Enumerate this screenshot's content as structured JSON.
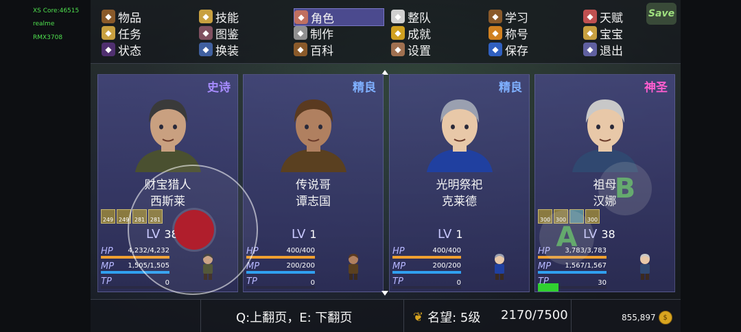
{
  "debug": [
    "XS Core:46515",
    "realme",
    "RMX3708"
  ],
  "menu": {
    "items": [
      {
        "label": "物品",
        "icon": "bag-icon",
        "color": "#8a5a2a"
      },
      {
        "label": "技能",
        "icon": "scroll-star-icon",
        "color": "#c8a040"
      },
      {
        "label": "角色",
        "icon": "masks-icon",
        "color": "#c07060",
        "active": true
      },
      {
        "label": "整队",
        "icon": "flag-icon",
        "color": "#d0d0d0"
      },
      {
        "label": "学习",
        "icon": "book-icon",
        "color": "#8a5a2a"
      },
      {
        "label": "天赋",
        "icon": "gift-icon",
        "color": "#c05050"
      },
      {
        "label": "任务",
        "icon": "quest-scroll-icon",
        "color": "#c8a040"
      },
      {
        "label": "图鉴",
        "icon": "monster-book-icon",
        "color": "#805060"
      },
      {
        "label": "制作",
        "icon": "anvil-icon",
        "color": "#909090"
      },
      {
        "label": "成就",
        "icon": "trophy-icon",
        "color": "#d0a020"
      },
      {
        "label": "称号",
        "icon": "medal-icon",
        "color": "#d08020"
      },
      {
        "label": "宝宝",
        "icon": "pet-icon",
        "color": "#c8a040"
      },
      {
        "label": "状态",
        "icon": "status-orb-icon",
        "color": "#503070"
      },
      {
        "label": "换装",
        "icon": "outfit-icon",
        "color": "#4060a0"
      },
      {
        "label": "百科",
        "icon": "encyclopedia-icon",
        "color": "#8a5a2a"
      },
      {
        "label": "设置",
        "icon": "gear-icon",
        "color": "#a07050"
      },
      {
        "label": "保存",
        "icon": "floppy-icon",
        "color": "#3060c0"
      },
      {
        "label": "退出",
        "icon": "exit-icon",
        "color": "#6060a0"
      }
    ],
    "save_label": "Save"
  },
  "characters": [
    {
      "rarity": "史诗",
      "rarity_color": "#a78cff",
      "name_line1": "财宝猎人",
      "name_line2": "西斯莱",
      "equip": [
        "249",
        "249",
        "281",
        "281"
      ],
      "lv_label": "LV",
      "lv": "38",
      "hp_label": "HP",
      "hp": "4,232/4,232",
      "hp_ratio": 1.0,
      "mp_label": "MP",
      "mp": "1,505/1,505",
      "mp_ratio": 1.0,
      "tp_label": "TP",
      "tp": "0",
      "tp_ratio": 0.0,
      "hair": "#3a3a3a",
      "skin": "#c9a080",
      "outfit": "#4a5030"
    },
    {
      "rarity": "精良",
      "rarity_color": "#7fb0ff",
      "name_line1": "传说哥",
      "name_line2": "谭志国",
      "equip": [],
      "lv_label": "LV",
      "lv": "1",
      "hp_label": "HP",
      "hp": "400/400",
      "hp_ratio": 1.0,
      "mp_label": "MP",
      "mp": "200/200",
      "mp_ratio": 1.0,
      "tp_label": "TP",
      "tp": "0",
      "tp_ratio": 0.0,
      "hair": "#5a3a20",
      "skin": "#b08060",
      "outfit": "#5a4020"
    },
    {
      "rarity": "精良",
      "rarity_color": "#7fb0ff",
      "name_line1": "光明祭祀",
      "name_line2": "克莱德",
      "equip": [],
      "lv_label": "LV",
      "lv": "1",
      "hp_label": "HP",
      "hp": "400/400",
      "hp_ratio": 1.0,
      "mp_label": "MP",
      "mp": "200/200",
      "mp_ratio": 1.0,
      "tp_label": "TP",
      "tp": "0",
      "tp_ratio": 0.0,
      "hair": "#9aa0b0",
      "skin": "#e8c8a8",
      "outfit": "#2040a0"
    },
    {
      "rarity": "神圣",
      "rarity_color": "#ff5ed0",
      "name_line1": "祖母",
      "name_line2": "汉娜",
      "equip": [
        "300",
        "300",
        "",
        "300"
      ],
      "lv_label": "LV",
      "lv": "38",
      "hp_label": "HP",
      "hp": "3,783/3,783",
      "hp_ratio": 1.0,
      "mp_label": "MP",
      "mp": "1,567/1,567",
      "mp_ratio": 1.0,
      "tp_label": "TP",
      "tp": "30",
      "tp_ratio": 0.3,
      "hair": "#c8c8c8",
      "skin": "#e8c8a8",
      "outfit": "#304870"
    }
  ],
  "bottom": {
    "hint": "Q:上翻页，E: 下翻页",
    "fame_label": "名望: 5级",
    "fame_value": "2170/7500",
    "gold": "855,897"
  },
  "gamepad": {
    "b_label": "B",
    "a_label": "A"
  },
  "colors": {
    "hp": "#f0a030",
    "mp": "#30a0f0",
    "tp": "#30d030"
  }
}
